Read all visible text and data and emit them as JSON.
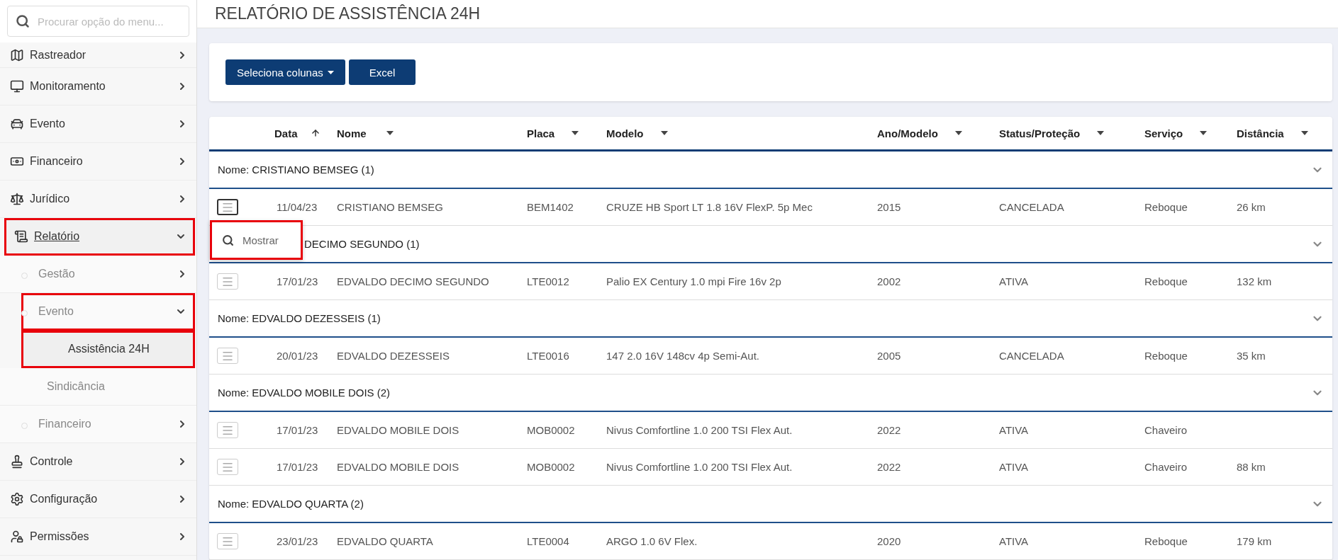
{
  "sidebar": {
    "search": {
      "placeholder": "Procurar opção do menu..."
    },
    "items": [
      {
        "label": "Rastreador",
        "expanded": false,
        "selected": false,
        "highlighted": false
      },
      {
        "label": "Monitoramento",
        "expanded": false,
        "selected": false,
        "highlighted": false
      },
      {
        "label": "Evento",
        "expanded": false,
        "selected": false,
        "highlighted": false
      },
      {
        "label": "Financeiro",
        "expanded": false,
        "selected": false,
        "highlighted": false
      },
      {
        "label": "Jurídico",
        "expanded": false,
        "selected": false,
        "highlighted": false
      },
      {
        "label": "Relatório",
        "expanded": true,
        "selected": true,
        "highlighted": true,
        "children": [
          {
            "label": "Gestão",
            "expanded": false,
            "selected": false,
            "highlighted": false
          },
          {
            "label": "Evento",
            "expanded": true,
            "selected": false,
            "highlighted": true,
            "children": [
              {
                "label": "Assistência 24H",
                "selected": true,
                "highlighted": true
              },
              {
                "label": "Sindicância",
                "selected": false,
                "highlighted": false
              }
            ]
          },
          {
            "label": "Financeiro",
            "expanded": false,
            "selected": false,
            "highlighted": false
          }
        ]
      },
      {
        "label": "Controle",
        "expanded": false,
        "selected": false,
        "highlighted": false
      },
      {
        "label": "Configuração",
        "expanded": false,
        "selected": false,
        "highlighted": false
      },
      {
        "label": "Permissões",
        "expanded": false,
        "selected": false,
        "highlighted": false
      }
    ]
  },
  "page": {
    "title": "RELATÓRIO DE ASSISTÊNCIA 24H"
  },
  "toolbar": {
    "buttons": [
      {
        "label": "Seleciona colunas",
        "kind": "dropdown"
      },
      {
        "label": "Excel",
        "kind": "plain"
      }
    ]
  },
  "table": {
    "columns": [
      {
        "label": "Data",
        "sorted": true
      },
      {
        "label": "Nome",
        "sorted": false
      },
      {
        "label": "Placa",
        "sorted": false
      },
      {
        "label": "Modelo",
        "sorted": false
      },
      {
        "label": "Ano/Modelo",
        "sorted": false
      },
      {
        "label": "Status/Proteção",
        "sorted": false
      },
      {
        "label": "Serviço",
        "sorted": false
      },
      {
        "label": "Distância",
        "sorted": false
      }
    ],
    "groups": [
      {
        "label": "Nome: CRISTIANO BEMSEG (1)",
        "expanded": true,
        "rows": [
          {
            "cells": [
              "11/04/23",
              "CRISTIANO BEMSEG",
              "BEM1402",
              "CRUZE HB Sport LT 1.8 16V FlexP. 5p Mec",
              "2015",
              "CANCELADA",
              "Reboque",
              "26 km"
            ],
            "menu_open": true,
            "menu": [
              {
                "label": "Mostrar"
              }
            ]
          }
        ]
      },
      {
        "label": "DECIMO SEGUNDO (1)",
        "expanded": true,
        "rows": [
          {
            "cells": [
              "17/01/23",
              "EDVALDO DECIMO SEGUNDO",
              "LTE0012",
              "Palio EX Century 1.0 mpi Fire 16v 2p",
              "2002",
              "ATIVA",
              "Reboque",
              "132 km"
            ],
            "menu_open": false
          }
        ]
      },
      {
        "label": "Nome: EDVALDO DEZESSEIS (1)",
        "expanded": true,
        "rows": [
          {
            "cells": [
              "20/01/23",
              "EDVALDO DEZESSEIS",
              "LTE0016",
              "147 2.0 16V 148cv 4p Semi-Aut.",
              "2005",
              "CANCELADA",
              "Reboque",
              "35 km"
            ],
            "menu_open": false
          }
        ]
      },
      {
        "label": "Nome: EDVALDO MOBILE DOIS (2)",
        "expanded": true,
        "rows": [
          {
            "cells": [
              "17/01/23",
              "EDVALDO MOBILE DOIS",
              "MOB0002",
              "Nivus Comfortline 1.0 200 TSI Flex Aut.",
              "2022",
              "ATIVA",
              "Chaveiro"
            ],
            "menu_open": false
          },
          {
            "cells": [
              "17/01/23",
              "EDVALDO MOBILE DOIS",
              "MOB0002",
              "Nivus Comfortline 1.0 200 TSI Flex Aut.",
              "2022",
              "ATIVA",
              "Chaveiro",
              "88 km"
            ],
            "menu_open": false
          }
        ]
      },
      {
        "label": "Nome: EDVALDO QUARTA (2)",
        "expanded": true,
        "rows": [
          {
            "cells": [
              "23/01/23",
              "EDVALDO QUARTA",
              "LTE0004",
              "ARGO 1.0 6V Flex.",
              "2020",
              "ATIVA",
              "Reboque",
              "179 km"
            ],
            "menu_open": false
          }
        ]
      }
    ]
  }
}
